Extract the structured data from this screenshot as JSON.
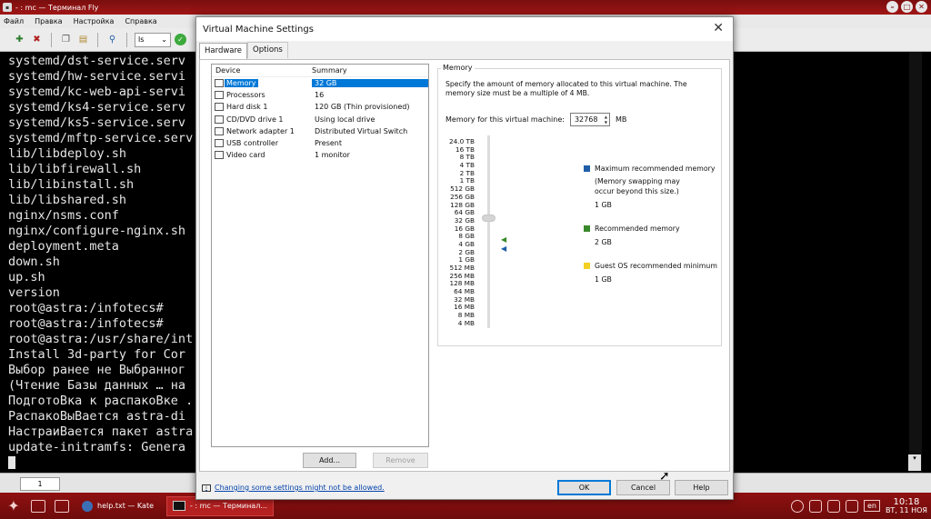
{
  "terminal": {
    "title": "- : mc — Терминал Fly",
    "menu": [
      "Файл",
      "Правка",
      "Настройка",
      "Справка"
    ],
    "toolbar_select": "ls",
    "lines": [
      "systemd/dst-service.serv",
      "systemd/hw-service.servi",
      "systemd/kc-web-api-servi",
      "systemd/ks4-service.serv",
      "systemd/ks5-service.serv",
      "systemd/mftp-service.serv",
      "lib/libdeploy.sh",
      "lib/libfirewall.sh",
      "lib/libinstall.sh",
      "lib/libshared.sh",
      "nginx/nsms.conf",
      "nginx/configure-nginx.sh",
      "deployment.meta",
      "down.sh",
      "up.sh",
      "version",
      "root@astra:/infotecs#",
      "root@astra:/infotecs#",
      "root@astra:/usr/share/int",
      "Install 3d-party for Cor",
      "Выбор ранее не Выбранног",
      "(Чтение Базы данных … на",
      "ПодготоВка к распакоВке .",
      "РаспакоВыВается astra-di",
      "НастраиВается пакет astra",
      "update-initramfs: Genera"
    ],
    "tab_label": "1"
  },
  "taskbar": {
    "items": [
      {
        "label": "help.txt — Kate",
        "icon": "kate-icon",
        "active": false
      },
      {
        "label": "- : mc — Терминал...",
        "icon": "terminal-icon",
        "active": true
      }
    ],
    "lang": "en",
    "time": "10:18",
    "date": "ВТ, 11 НОЯ"
  },
  "dialog": {
    "title": "Virtual Machine Settings",
    "tabs": [
      {
        "label": "Hardware",
        "active": true
      },
      {
        "label": "Options",
        "active": false
      }
    ],
    "device_header": "Device",
    "summary_header": "Summary",
    "devices": [
      {
        "name": "Memory",
        "summary": "32 GB",
        "selected": true
      },
      {
        "name": "Processors",
        "summary": "16",
        "selected": false
      },
      {
        "name": "Hard disk 1",
        "summary": "120 GB (Thin provisioned)",
        "selected": false
      },
      {
        "name": "CD/DVD drive 1",
        "summary": "Using local drive",
        "selected": false
      },
      {
        "name": "Network adapter 1",
        "summary": "Distributed Virtual Switch",
        "selected": false
      },
      {
        "name": "USB controller",
        "summary": "Present",
        "selected": false
      },
      {
        "name": "Video card",
        "summary": "1 monitor",
        "selected": false
      }
    ],
    "add_label": "Add...",
    "remove_label": "Remove",
    "memory": {
      "group_title": "Memory",
      "description": "Specify the amount of memory allocated to this virtual machine. The memory size must be a multiple of 4 MB.",
      "field_label": "Memory for this virtual machine:",
      "value": "32768",
      "unit": "MB",
      "scale": [
        "24.0 TB",
        "16 TB",
        "8 TB",
        "4 TB",
        "2 TB",
        "1 TB",
        "512 GB",
        "256 GB",
        "128 GB",
        "64 GB",
        "32 GB",
        "16 GB",
        "8 GB",
        "4 GB",
        "2 GB",
        "1 GB",
        "512 MB",
        "256 MB",
        "128 MB",
        "64 MB",
        "32 MB",
        "16 MB",
        "8 MB",
        "4 MB"
      ],
      "legend": [
        {
          "title": "Maximum recommended memory",
          "note": "(Memory swapping may occur beyond this size.)",
          "value": "1 GB",
          "color": "#1f5fa8"
        },
        {
          "title": "Recommended memory",
          "note": "",
          "value": "2 GB",
          "color": "#3a8a2c"
        },
        {
          "title": "Guest OS recommended minimum",
          "note": "",
          "value": "1 GB",
          "color": "#f2d024"
        }
      ]
    },
    "footer_link": "Changing some settings might not be allowed.",
    "ok_label": "OK",
    "cancel_label": "Cancel",
    "help_label": "Help"
  }
}
